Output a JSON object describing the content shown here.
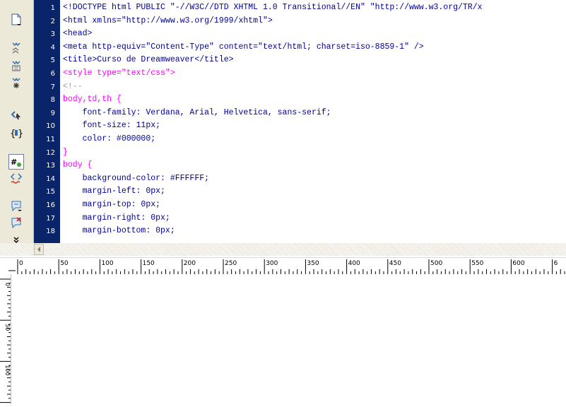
{
  "toolbar": {
    "icons": [
      "open-documents-icon",
      "collapse-full-tag-icon",
      "collapse-selection-icon",
      "expand-all-icon",
      "select-parent-tag-icon",
      "balance-braces-icon",
      "line-numbers-icon",
      "highlight-invalid-code-icon",
      "apply-comment-icon",
      "remove-comment-icon",
      "more-icon"
    ]
  },
  "line_numbers": [
    "1",
    "2",
    "3",
    "4",
    "5",
    "6",
    "7",
    "8",
    "9",
    "10",
    "11",
    "12",
    "13",
    "14",
    "15",
    "16",
    "17",
    "18"
  ],
  "code_lines": [
    {
      "class": "tag",
      "text": "<!DOCTYPE html PUBLIC \"-//W3C//DTD XHTML 1.0 Transitional//EN\" \"http://www.w3.org/TR/x"
    },
    {
      "class": "tag",
      "text": "<html xmlns=\"http://www.w3.org/1999/xhtml\">"
    },
    {
      "class": "tag",
      "text": "<head>"
    },
    {
      "class": "tag",
      "text": "<meta http-equiv=\"Content-Type\" content=\"text/html; charset=iso-8859-1\" />"
    },
    {
      "class": "tag",
      "text": "<title>Curso de Dreamweaver</title>"
    },
    {
      "class": "css-sel",
      "text": "<style type=\"text/css\">"
    },
    {
      "class": "comment",
      "text": "<!--"
    },
    {
      "class": "css-sel",
      "text": "body,td,th {"
    },
    {
      "class": "css-prop",
      "text": "    font-family: Verdana, Arial, Helvetica, sans-serif;"
    },
    {
      "class": "css-prop",
      "text": "    font-size: 11px;"
    },
    {
      "class": "css-prop",
      "text": "    color: #000000;"
    },
    {
      "class": "css-sel",
      "text": "}"
    },
    {
      "class": "css-sel",
      "text": "body {"
    },
    {
      "class": "css-prop",
      "text": "    background-color: #FFFFFF;"
    },
    {
      "class": "css-prop",
      "text": "    margin-left: 0px;"
    },
    {
      "class": "css-prop",
      "text": "    margin-top: 0px;"
    },
    {
      "class": "css-prop",
      "text": "    margin-right: 0px;"
    },
    {
      "class": "css-prop",
      "text": "    margin-bottom: 0px;"
    }
  ],
  "ruler": {
    "top_labels": [
      "0",
      "50",
      "100",
      "150",
      "200",
      "250",
      "300",
      "350",
      "400",
      "450",
      "500",
      "550",
      "600",
      "6"
    ],
    "left_labels": [
      "0",
      "50",
      "100"
    ]
  }
}
